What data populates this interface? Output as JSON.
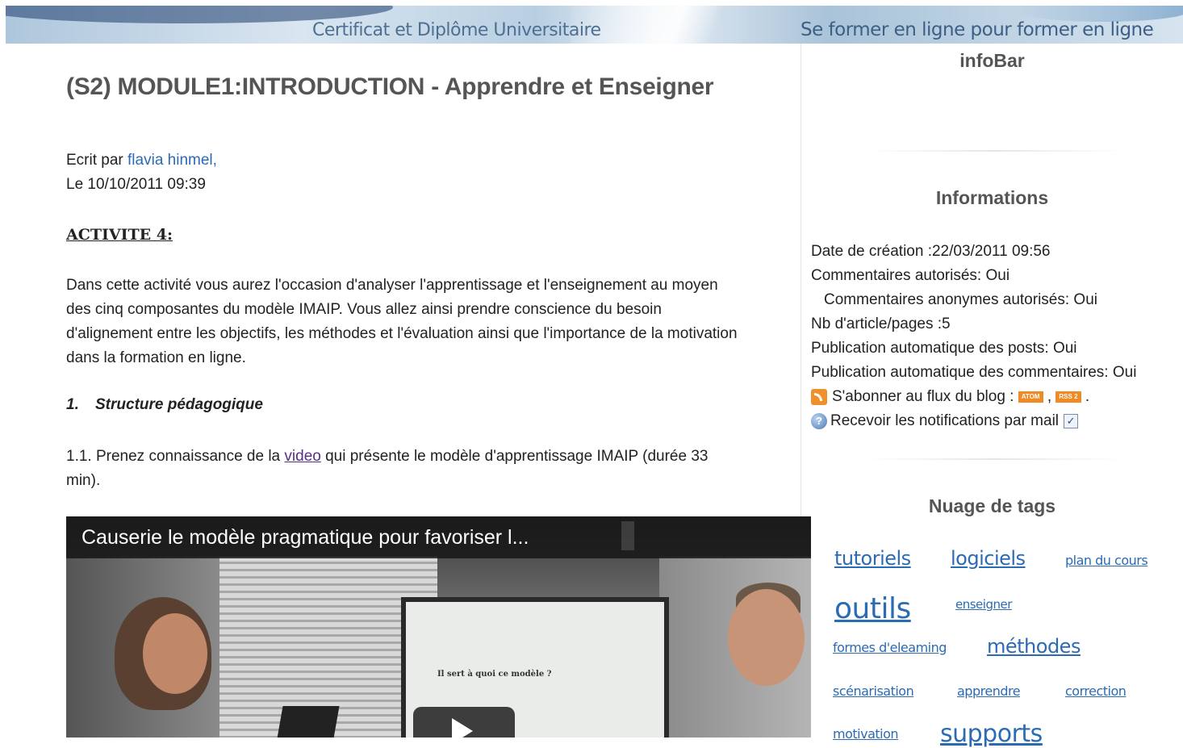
{
  "banner": {
    "left_text": "Certificat et Diplôme Universitaire",
    "right_text": "Se former en ligne pour former en ligne"
  },
  "post": {
    "title": "(S2) MODULE1:INTRODUCTION - Apprendre et Enseigner",
    "author_prefix": "Ecrit par",
    "author": "flavia hinmel",
    "author_suffix": ",",
    "date_line": "Le 10/10/2011 09:39",
    "activity": "ACTIVITE 4:",
    "paragraph": "Dans cette activité vous aurez l'occasion d'analyser l'apprentissage et l'enseignement au moyen des cinq composantes du modèle IMAIP. Vous allez ainsi prendre conscience du besoin d'alignement entre les objectifs, les méthodes et l'évaluation ainsi que l'importance de la motivation dans la formation en ligne.",
    "section_num": "1.",
    "section_title": "Structure pédagogique",
    "instr_before": "1.1. Prenez connaissance de la ",
    "instr_link": "video",
    "instr_after": " qui présente le modèle d'apprentissage IMAIP (durée 33 min)."
  },
  "video": {
    "caption": "Causerie le modèle pragmatique pour favoriser l...",
    "screen_text": "Il sert à quoi ce modèle ?"
  },
  "sidebar": {
    "infobar_title": "infoBar",
    "info_title": "Informations",
    "info": {
      "created": "Date de création :22/03/2011 09:56",
      "comments": "Commentaires autorisés: Oui",
      "anon_comments": "Commentaires anonymes autorisés: Oui",
      "article_count": "Nb d'article/pages :5",
      "auto_posts": "Publication automatique des posts: Oui",
      "auto_comments": "Publication automatique des commentaires: Oui",
      "subscribe": "S'abonner au flux du blog :",
      "atom_badge": "ATOM",
      "rss_badge": "RSS 2",
      "comma": ",",
      "period": ".",
      "notify": "Recevoir les notifications par mail"
    },
    "tags_title": "Nuage de tags",
    "tags": [
      "tutoriels",
      "logiciels",
      "plan du cours",
      "outils",
      "enseigner",
      "formes d'eleaming",
      "méthodes",
      "scénarisation",
      "apprendre",
      "correction",
      "motivation",
      "supports"
    ]
  },
  "colors": {
    "link": "#2b6bb3",
    "visited_link": "#5a2d8c",
    "heading": "#555555"
  },
  "icons": {
    "rss": "rss-icon",
    "help": "help-icon",
    "checkbox": "checkbox-icon",
    "play": "play-icon"
  }
}
